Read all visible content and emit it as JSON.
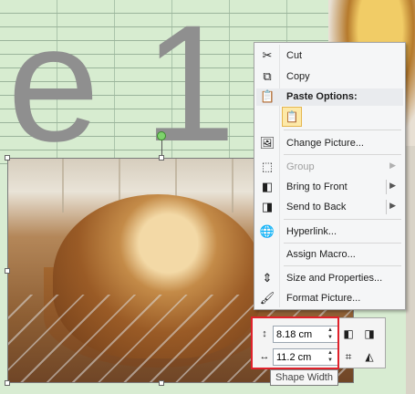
{
  "worksheet": {
    "big_text": "e1"
  },
  "context_menu": {
    "items": [
      {
        "label": "Cut",
        "icon": "scissors-icon",
        "enabled": true
      },
      {
        "label": "Copy",
        "icon": "copy-icon",
        "enabled": true
      },
      {
        "label": "Paste Options:",
        "icon": "paste-icon",
        "enabled": true
      },
      {
        "label": "Change Picture...",
        "icon": "change-picture-icon",
        "enabled": true
      },
      {
        "label": "Group",
        "icon": "group-icon",
        "enabled": false
      },
      {
        "label": "Bring to Front",
        "icon": "bring-to-front-icon",
        "enabled": true
      },
      {
        "label": "Send to Back",
        "icon": "send-to-back-icon",
        "enabled": true
      },
      {
        "label": "Hyperlink...",
        "icon": "hyperlink-icon",
        "enabled": true
      },
      {
        "label": "Assign Macro...",
        "icon": "",
        "enabled": true
      },
      {
        "label": "Size and Properties...",
        "icon": "size-properties-icon",
        "enabled": true
      },
      {
        "label": "Format Picture...",
        "icon": "format-picture-icon",
        "enabled": true
      }
    ]
  },
  "mini_toolbar": {
    "height_value": "8.18 cm",
    "width_value": "11.2 cm",
    "tooltip": "Shape Width"
  },
  "colors": {
    "selection_box": "#e0212b",
    "menu_bg": "#f5f6f7",
    "rotation_handle": "#7ed36c"
  }
}
